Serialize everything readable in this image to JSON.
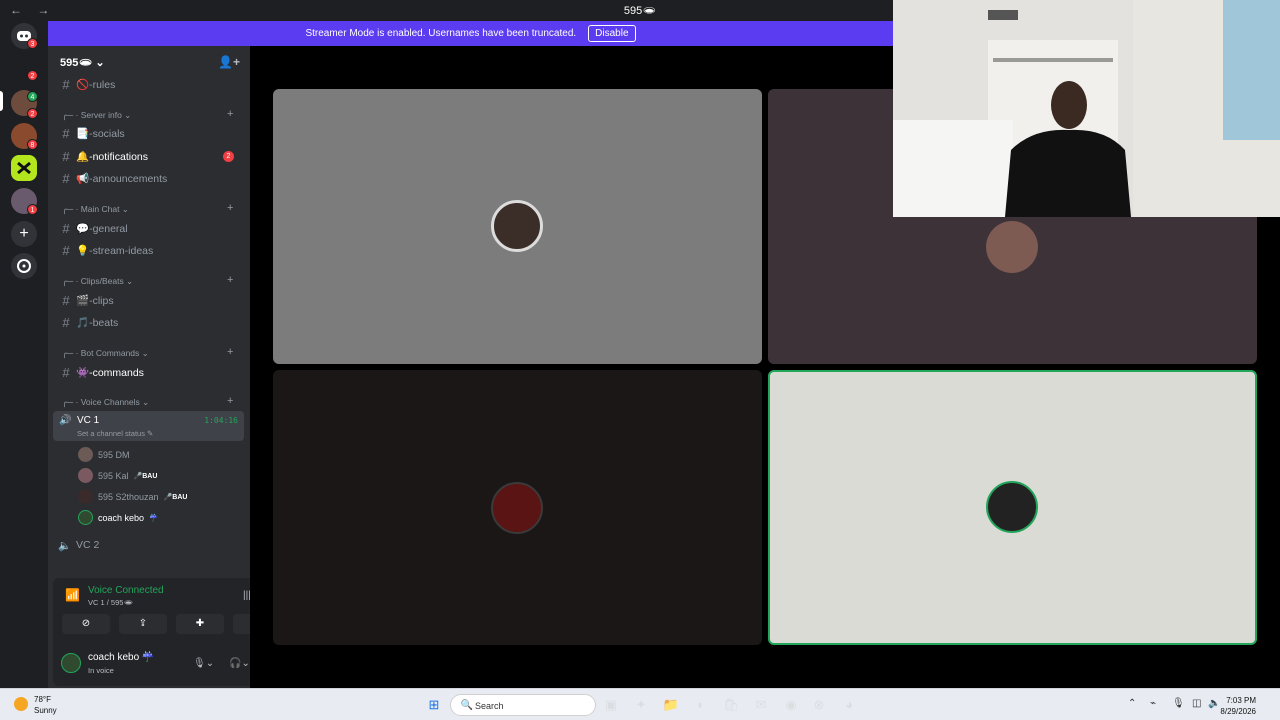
{
  "titlebar": {
    "nav": "← →",
    "title": "595🕳"
  },
  "banner": {
    "text": "Streamer Mode is enabled. Usernames have been truncated.",
    "button": "Disable"
  },
  "guilds": {
    "badges": [
      "3",
      "2",
      "4",
      "2",
      "8",
      "1"
    ]
  },
  "server": {
    "name": "595🕳 ⌄"
  },
  "channels": [
    {
      "name": "🚫-rules",
      "unread": false
    },
    {
      "name": "📑-socials",
      "unread": false
    },
    {
      "name": "🔔-notifications",
      "unread": true,
      "badge": "2"
    },
    {
      "name": "📢-announcements",
      "unread": false
    },
    {
      "name": "💬-general",
      "unread": false
    },
    {
      "name": "💡-stream-ideas",
      "unread": false
    },
    {
      "name": "🎬-clips",
      "unread": false
    },
    {
      "name": "🎵-beats",
      "unread": false
    },
    {
      "name": "👾-commands",
      "unread": true
    }
  ],
  "categories": [
    "Server info ⌄",
    "Main Chat ⌄",
    "Clips/Beats ⌄",
    "Bot Commands ⌄",
    "Voice Channels ⌄"
  ],
  "voice": {
    "vc1": {
      "name": "VC 1",
      "time": "1:04:16",
      "status": "Set a channel status ✎"
    },
    "members": [
      {
        "name": "595 DM",
        "tag": ""
      },
      {
        "name": "595 Kal",
        "tag": "🎤BAU"
      },
      {
        "name": "595 S2thouzan",
        "tag": "🎤BAU"
      },
      {
        "name": "coach kebo",
        "tag": "☔"
      }
    ],
    "vc2": "VC 2"
  },
  "panel": {
    "title": "Voice Connected",
    "sub": "VC 1 / 595🕳",
    "user": "coach kebo ☔",
    "user_status": "In voice"
  },
  "taskbar": {
    "temp": "78°F",
    "cond": "Sunny",
    "search": "Search",
    "time": "7:03 PM",
    "date": "8/29/2026"
  },
  "colors": {
    "accent": "#5b3cf0",
    "green": "#23a55a",
    "red": "#f23f43"
  }
}
